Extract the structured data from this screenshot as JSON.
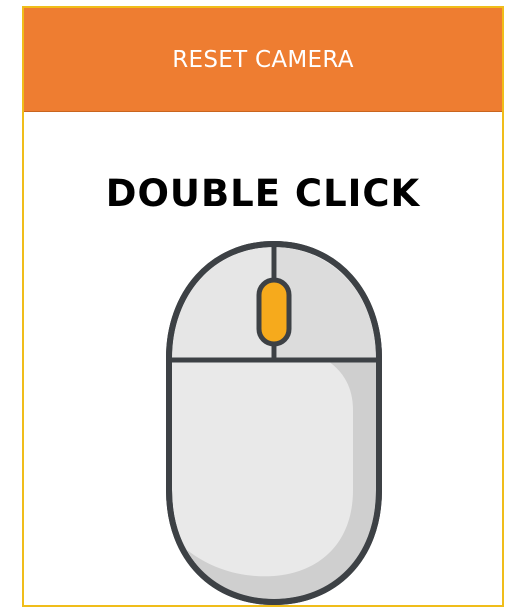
{
  "header": {
    "title": "RESET CAMERA"
  },
  "instruction": {
    "text": "DOUBLE CLICK"
  },
  "icon": {
    "name": "mouse-icon",
    "highlight_part": "scroll-wheel",
    "highlight_color": "#f6aa1c",
    "body_color": "#e9e9e9",
    "outline_color": "#3d4145"
  },
  "colors": {
    "header_bg": "#ee7d31",
    "frame_border": "#f0bd1a",
    "header_text": "#ffffff",
    "instruction_text": "#000000"
  }
}
